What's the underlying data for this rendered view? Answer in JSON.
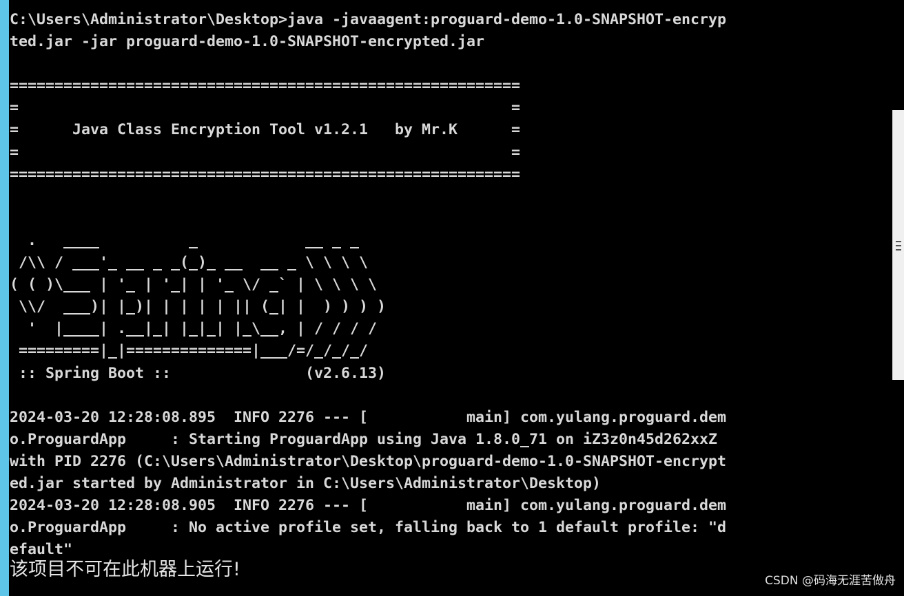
{
  "console": {
    "lines": [
      "C:\\Users\\Administrator\\Desktop>java -javaagent:proguard-demo-1.0-SNAPSHOT-encryp",
      "ted.jar -jar proguard-demo-1.0-SNAPSHOT-encrypted.jar",
      "",
      "=========================================================",
      "=                                                       =",
      "=      Java Class Encryption Tool v1.2.1   by Mr.K      =",
      "=                                                       =",
      "=========================================================",
      "",
      "",
      "  .   ____          _            __ _ _",
      " /\\\\ / ___'_ __ _ _(_)_ __  __ _ \\ \\ \\ \\",
      "( ( )\\___ | '_ | '_| | '_ \\/ _` | \\ \\ \\ \\",
      " \\\\/  ___)| |_)| | | | | || (_| |  ) ) ) )",
      "  '  |____| .__|_| |_|_| |_\\__, | / / / /",
      " =========|_|==============|___/=/_/_/_/",
      " :: Spring Boot ::               (v2.6.13)",
      "",
      "2024-03-20 12:28:08.895  INFO 2276 --- [           main] com.yulang.proguard.dem",
      "o.ProguardApp     : Starting ProguardApp using Java 1.8.0_71 on iZ3z0n45d262xxZ",
      "with PID 2276 (C:\\Users\\Administrator\\Desktop\\proguard-demo-1.0-SNAPSHOT-encrypt",
      "ed.jar started by Administrator in C:\\Users\\Administrator\\Desktop)",
      "2024-03-20 12:28:08.905  INFO 2276 --- [           main] com.yulang.proguard.dem",
      "o.ProguardApp     : No active profile set, falling back to 1 default profile: \"d",
      "efault\""
    ],
    "error_message": "该项目不可在此机器上运行!"
  },
  "watermark": "CSDN @码海无涯苦做舟",
  "colors": {
    "background": "#000000",
    "text": "#d8d8d8",
    "left_edge": "#5fc5e8",
    "scrollbar": "#f0f0f0"
  }
}
